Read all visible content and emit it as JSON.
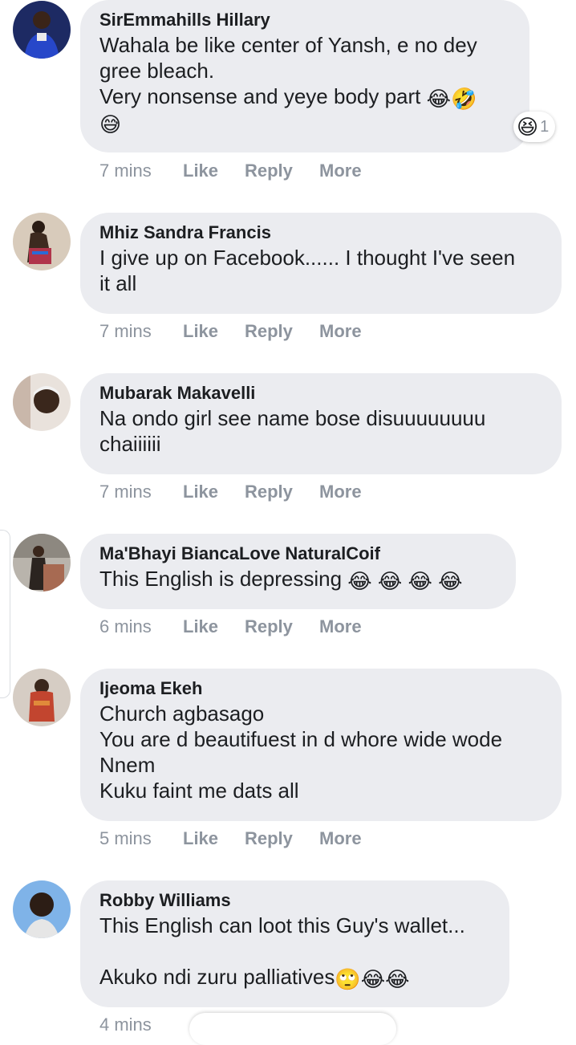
{
  "comments": [
    {
      "author": "SirEmmahills Hillary",
      "text": "Wahala be like center of Yansh, e no dey\ngree bleach.\nVery nonsense and yeye body part ",
      "emoji_inline": "😂🤣",
      "emoji_tail": "😅",
      "time": "7 mins",
      "like": "Like",
      "reply": "Reply",
      "more": "More",
      "reaction": {
        "icon": "laughing-face-icon",
        "emoji": "😆",
        "count": "1"
      }
    },
    {
      "author": "Mhiz Sandra Francis",
      "text": "I give up on Facebook...... I thought I've seen\nit all",
      "time": "7 mins",
      "like": "Like",
      "reply": "Reply",
      "more": "More"
    },
    {
      "author": "Mubarak Makavelli",
      "text": "Na ondo girl see name bose disuuuuuuuu\nchaiiiiii",
      "time": "7 mins",
      "like": "Like",
      "reply": "Reply",
      "more": "More"
    },
    {
      "author": "Ma'Bhayi BiancaLove NaturalCoif",
      "text": "This English is depressing ",
      "emoji_inline": "😂 😂 😂 😂",
      "time": "6 mins",
      "like": "Like",
      "reply": "Reply",
      "more": "More"
    },
    {
      "author": "Ijeoma Ekeh",
      "text": "Church agbasago\nYou are d beautifuest in d whore wide wode\nNnem\nKuku faint me dats all",
      "time": "5 mins",
      "like": "Like",
      "reply": "Reply",
      "more": "More"
    },
    {
      "author": "Robby Williams",
      "text": "This English can loot this Guy's wallet...\n\nAkuko ndi zuru palliatives",
      "emoji_inline": "🙄😂😂",
      "time": "4 mins"
    }
  ]
}
